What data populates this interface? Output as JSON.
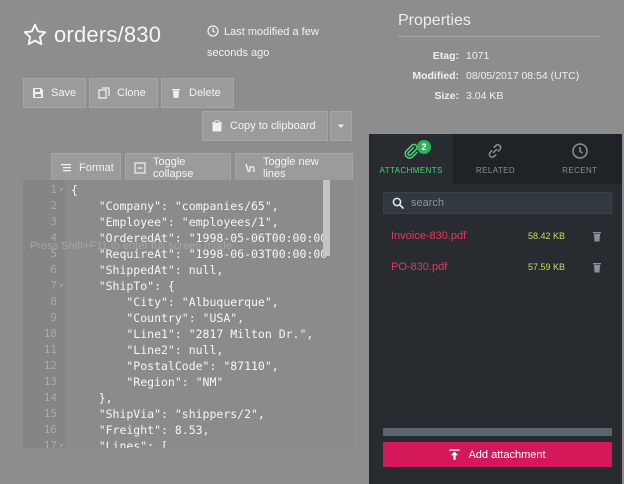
{
  "header": {
    "title": "orders/830",
    "last_modified": "Last modified a few seconds ago"
  },
  "properties": {
    "title": "Properties",
    "rows": [
      {
        "key": "Etag:",
        "value": "1071"
      },
      {
        "key": "Modified:",
        "value": "08/05/2017 08:54 (UTC)"
      },
      {
        "key": "Size:",
        "value": "3.04 KB"
      }
    ]
  },
  "toolbar": {
    "save": "Save",
    "clone": "Clone",
    "delete": "Delete",
    "copy": "Copy to clipboard"
  },
  "editor_toolbar": {
    "format": "Format",
    "toggle_collapse": "Toggle collapse",
    "toggle_lines": "Toggle new lines"
  },
  "editor": {
    "hint": "Press Shift+F11 to enter full screen mode",
    "lines": [
      {
        "n": "1",
        "fold": true,
        "code": "{"
      },
      {
        "n": "2",
        "fold": false,
        "code": "    \"Company\": \"companies/65\","
      },
      {
        "n": "3",
        "fold": false,
        "code": "    \"Employee\": \"employees/1\","
      },
      {
        "n": "4",
        "fold": false,
        "code": "    \"OrderedAt\": \"1998-05-06T00:00:00"
      },
      {
        "n": "5",
        "fold": false,
        "code": "    \"RequireAt\": \"1998-06-03T00:00:00"
      },
      {
        "n": "6",
        "fold": false,
        "code": "    \"ShippedAt\": null,"
      },
      {
        "n": "7",
        "fold": true,
        "code": "    \"ShipTo\": {"
      },
      {
        "n": "8",
        "fold": false,
        "code": "        \"City\": \"Albuquerque\","
      },
      {
        "n": "9",
        "fold": false,
        "code": "        \"Country\": \"USA\","
      },
      {
        "n": "10",
        "fold": false,
        "code": "        \"Line1\": \"2817 Milton Dr.\","
      },
      {
        "n": "11",
        "fold": false,
        "code": "        \"Line2\": null,"
      },
      {
        "n": "12",
        "fold": false,
        "code": "        \"PostalCode\": \"87110\","
      },
      {
        "n": "13",
        "fold": false,
        "code": "        \"Region\": \"NM\""
      },
      {
        "n": "14",
        "fold": false,
        "code": "    },"
      },
      {
        "n": "15",
        "fold": false,
        "code": "    \"ShipVia\": \"shippers/2\","
      },
      {
        "n": "16",
        "fold": false,
        "code": "    \"Freight\": 8.53,"
      },
      {
        "n": "17",
        "fold": true,
        "code": "    \"Lines\": ["
      }
    ]
  },
  "panel": {
    "tabs": [
      {
        "label": "ATTACHMENTS",
        "badge": "2",
        "active": true
      },
      {
        "label": "RELATED",
        "active": false
      },
      {
        "label": "RECENT",
        "active": false
      }
    ],
    "search_placeholder": "search",
    "attachments": [
      {
        "name": "Invoice-830.pdf",
        "size": "58.42 KB"
      },
      {
        "name": "PO-830.pdf",
        "size": "57.59 KB"
      }
    ],
    "add_label": "Add attachment"
  },
  "colors": {
    "accent": "#d4195a",
    "attachment_name": "#e8365c",
    "attachment_size": "#bfe15a",
    "active_tab": "#49d17c"
  }
}
